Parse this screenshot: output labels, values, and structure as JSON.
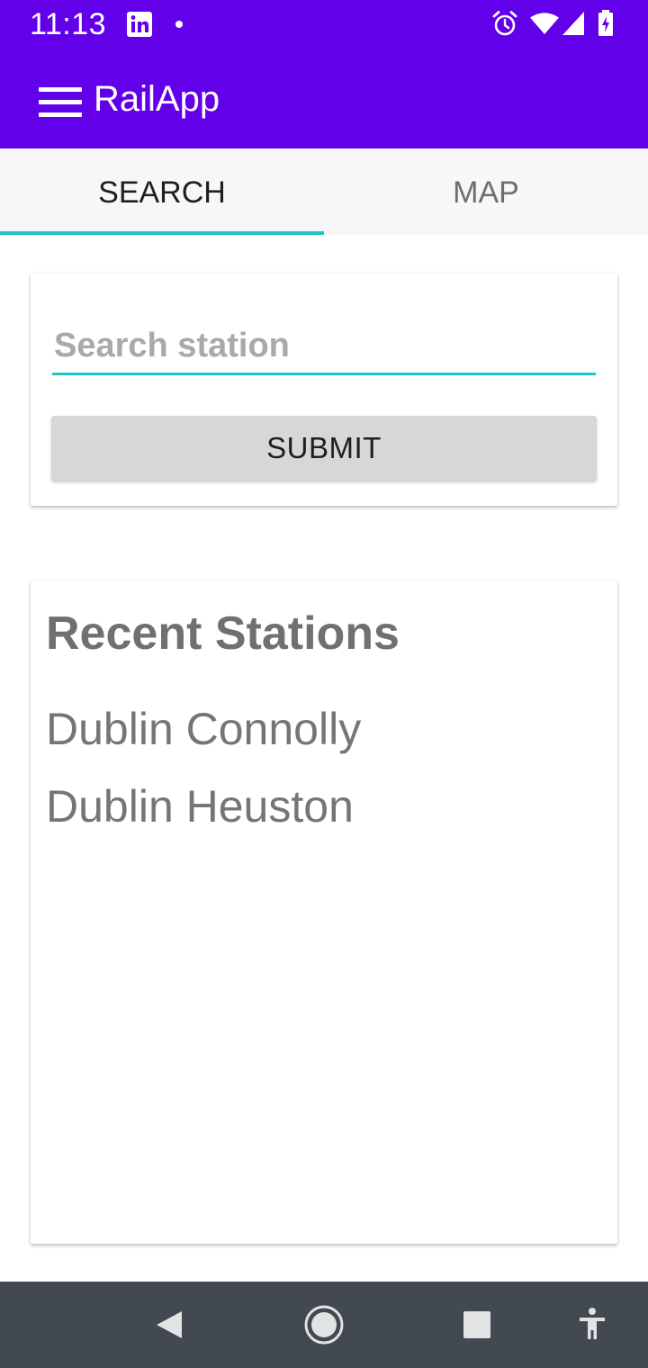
{
  "status_bar": {
    "time": "11:13",
    "icons": [
      "linkedin-icon",
      "notification-dot-icon",
      "alarm-icon",
      "wifi-icon",
      "cell-signal-icon",
      "battery-charging-icon"
    ]
  },
  "app_bar": {
    "title": "RailApp",
    "menu_icon": "hamburger-menu-icon",
    "background_color": "#6200ea"
  },
  "tabs": {
    "items": [
      {
        "label": "SEARCH",
        "selected": true
      },
      {
        "label": "MAP",
        "selected": false
      }
    ],
    "indicator_color": "#1ac6c6"
  },
  "search": {
    "value": "",
    "placeholder": "Search station",
    "submit_label": "SUBMIT"
  },
  "recent": {
    "title": "Recent Stations",
    "stations": [
      "Dublin Connolly",
      "Dublin Heuston"
    ]
  },
  "nav_bar": {
    "icons": [
      "back-icon",
      "home-icon",
      "recents-icon",
      "accessibility-icon"
    ]
  }
}
